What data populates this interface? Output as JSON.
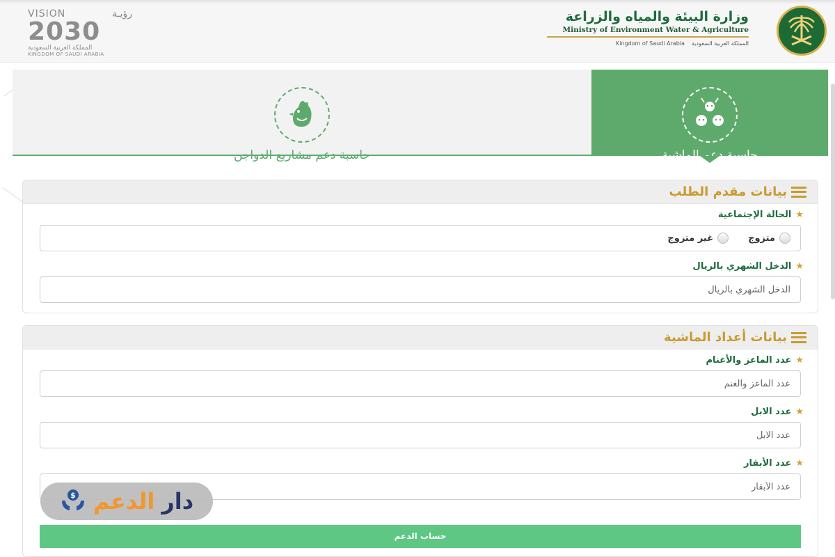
{
  "header": {
    "vision": {
      "label": "VISION",
      "label_ar": "رؤيـة",
      "year": "2030",
      "kingdom_ar": "المملكة العربية السعودية",
      "kingdom_en": "KINGDOM OF SAUDI ARABIA"
    },
    "ministry": {
      "name_ar": "وزارة البيئة والمياه والزراعة",
      "name_en": "Ministry of Environment Water & Agriculture",
      "kingdom_en": "Kingdom of Saudi Arabia",
      "kingdom_ar": "المملكة العربية السعودية"
    }
  },
  "tabs": [
    {
      "label": "حاسبة دعم الماشية",
      "active": true,
      "icon": "livestock-icon"
    },
    {
      "label": "حاسبة دعم مشاريع الدواجن",
      "active": false,
      "icon": "poultry-icon"
    }
  ],
  "applicant": {
    "title": "بيانات مقدم الطلب",
    "marital_label": "الحالة الإجتماعية",
    "options": [
      "متزوج",
      "غير متزوج"
    ],
    "income_label": "الدخل الشهري بالريال",
    "income_placeholder": "الدخل الشهري بالريال"
  },
  "livestock": {
    "title": "بيانات أعداد الماشية",
    "goats_label": "عدد الماعز والأغنام",
    "goats_placeholder": "عدد الماعز والغنم",
    "camels_label": "عدد الابل",
    "camels_placeholder": "عدد الابل",
    "cows_label": "عدد الأبقار",
    "cows_placeholder": "عدد الأبقار"
  },
  "submit_label": "حساب الدعم",
  "watermark": {
    "part1": "دار",
    "part2": "الدعم"
  },
  "colors": {
    "primary_green": "#5eaa6c",
    "gold": "#c99a2e",
    "dark_green": "#1f6b3e",
    "button_green": "#5ec784"
  }
}
